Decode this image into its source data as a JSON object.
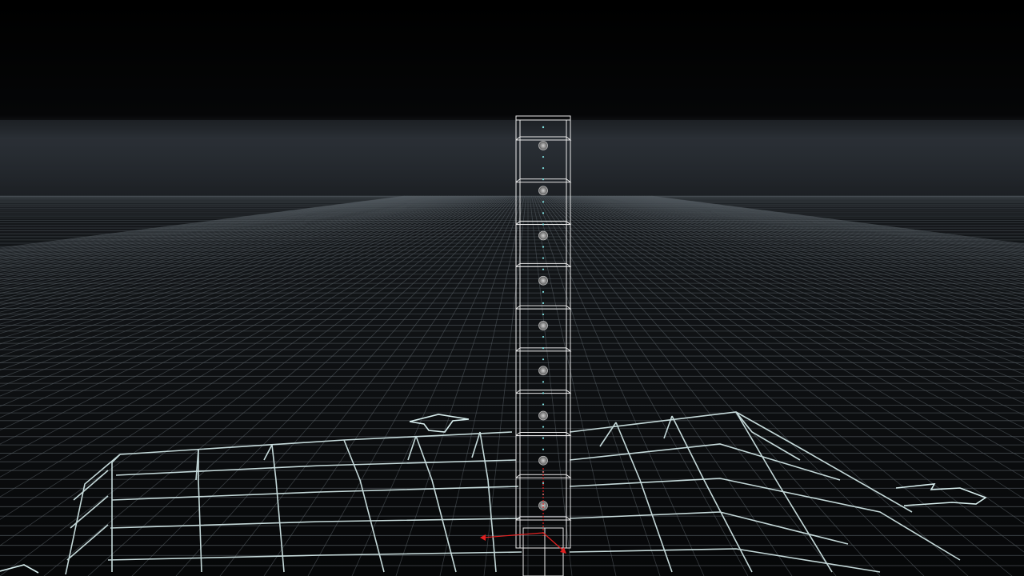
{
  "viewport": {
    "view": "perspective",
    "colors": {
      "background_top": "#000000",
      "horizon_glow": "#2a2f35",
      "ground": "#0c0e10",
      "grid_line": "#5a6268",
      "ground_grid_bright": "#d8eeee",
      "rig_wireframe": "#e8e8e8",
      "joint_points": "#7fe0e0",
      "axis_x": "#e02020",
      "axis_y": "#e02020"
    },
    "rig": {
      "type": "wireframe-column",
      "segments": 9,
      "joints": 9,
      "joint_icon": "sphere-joint-icon"
    },
    "ground_overlay": {
      "type": "deformed-grid-lines",
      "arrows": [
        "left-arrow-icon",
        "right-arrow-icon",
        "up-arrow-icon"
      ]
    },
    "gizmo": {
      "icon": "transform-axis-icon"
    }
  }
}
